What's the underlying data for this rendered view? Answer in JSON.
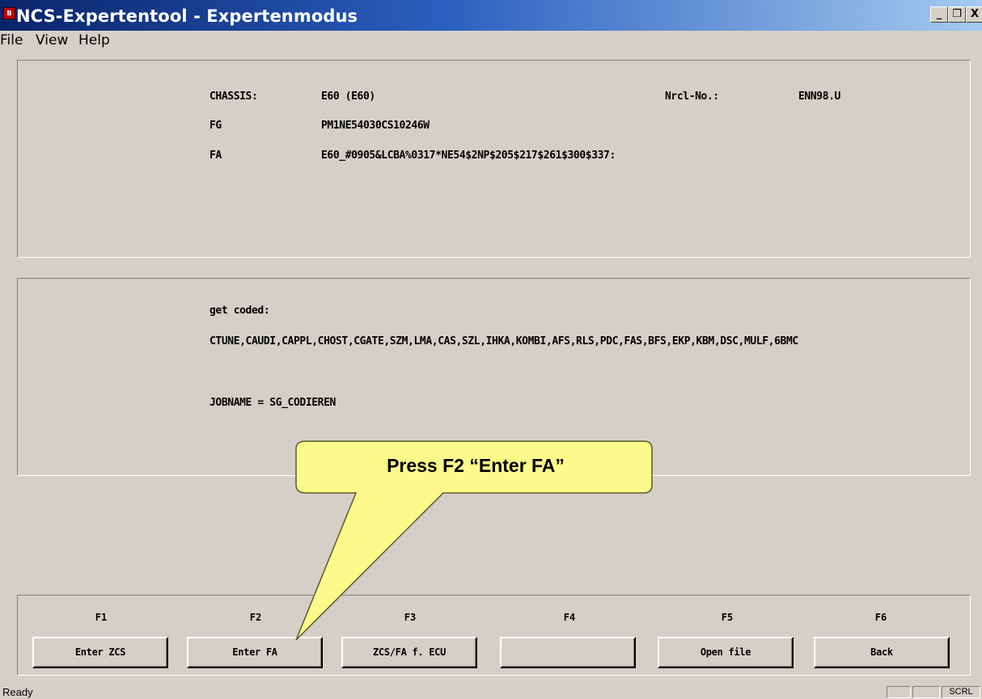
{
  "window": {
    "icon_text": "B",
    "title": "NCS-Expertentool - Expertenmodus",
    "minimize": "_",
    "restore": "❐",
    "close": "X"
  },
  "menu": [
    "File",
    "View",
    "Help"
  ],
  "vehicle": {
    "chassis_label": "CHASSIS:",
    "chassis_value": "E60 (E60)",
    "nrcl_label": "Nrcl-No.:",
    "nrcl_value": "ENN98.U",
    "fg_label": "FG",
    "fg_value": "PM1NE54030CS10246W",
    "fa_label": "FA",
    "fa_value": "E60_#0905&LCBA%0317*NE54$2NP$205$217$261$300$337:"
  },
  "coding": {
    "get_coded_label": "get coded:",
    "ecu_list": "CTUNE,CAUDI,CAPPL,CHOST,CGATE,SZM,LMA,CAS,SZL,IHKA,KOMBI,AFS,RLS,PDC,FAS,BFS,EKP,KBM,DSC,MULF,6BMC",
    "jobname": "JOBNAME = SG_CODIEREN"
  },
  "function_keys": [
    {
      "key": "F1",
      "label": "Enter ZCS"
    },
    {
      "key": "F2",
      "label": "Enter FA"
    },
    {
      "key": "F3",
      "label": "ZCS/FA f. ECU"
    },
    {
      "key": "F4",
      "label": ""
    },
    {
      "key": "F5",
      "label": "Open file"
    },
    {
      "key": "F6",
      "label": "Back"
    }
  ],
  "callout": {
    "text": "Press F2 “Enter FA”",
    "fill_color": "#fdf98a"
  },
  "statusbar": {
    "text": "Ready",
    "pane3": "SCRL"
  }
}
